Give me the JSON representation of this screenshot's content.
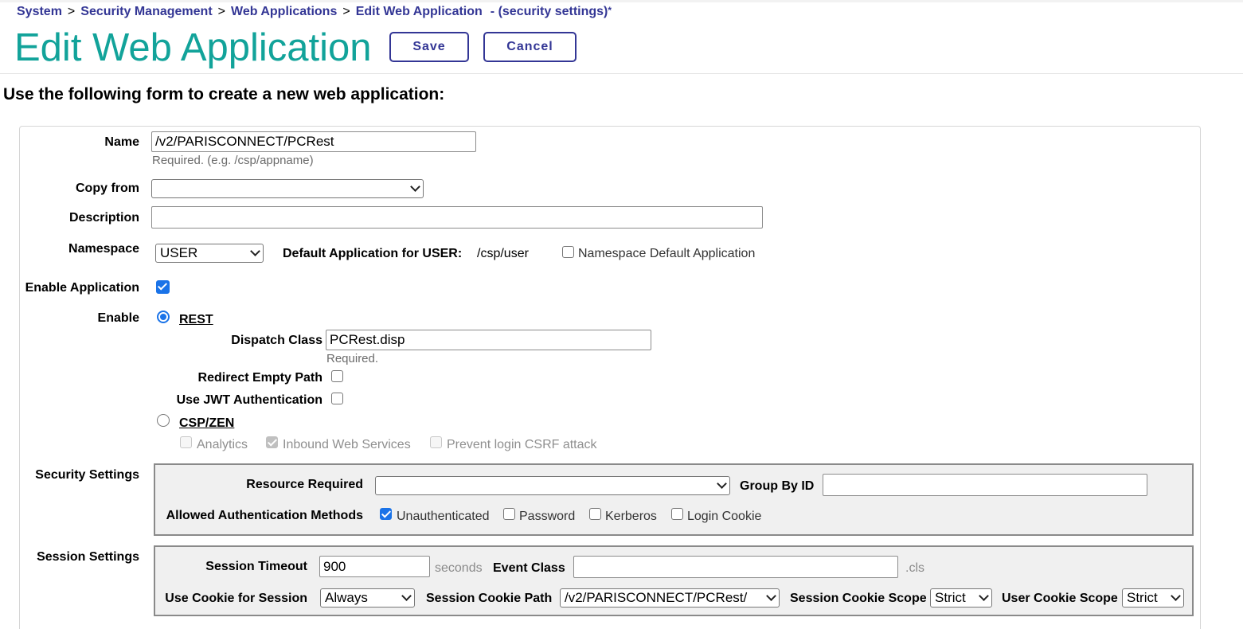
{
  "breadcrumb": {
    "items": [
      "System",
      "Security Management",
      "Web Applications",
      "Edit Web Application"
    ],
    "separator": ">",
    "suffix": "- (security settings)",
    "dirty_marker": "*"
  },
  "header": {
    "title": "Edit Web Application",
    "save_label": "Save",
    "cancel_label": "Cancel"
  },
  "intro": "Use the following form to create a new web application:",
  "form": {
    "name": {
      "label": "Name",
      "value": "/v2/PARISCONNECT/PCRest",
      "hint": "Required. (e.g. /csp/appname)"
    },
    "copy_from": {
      "label": "Copy from",
      "value": ""
    },
    "description": {
      "label": "Description",
      "value": ""
    },
    "namespace": {
      "label": "Namespace",
      "value": "USER",
      "default_app_label": "Default Application for USER:",
      "default_app_value": "/csp/user",
      "ns_default_label": "Namespace Default Application",
      "ns_default_checked": false
    },
    "enable_application": {
      "label": "Enable Application",
      "checked": true
    },
    "enable": {
      "label": "Enable",
      "rest": {
        "label": "REST",
        "selected": true,
        "dispatch_class_label": "Dispatch Class",
        "dispatch_class_value": "PCRest.disp",
        "dispatch_hint": "Required.",
        "redirect_empty_path_label": "Redirect Empty Path",
        "redirect_empty_path_checked": false,
        "use_jwt_label": "Use JWT Authentication",
        "use_jwt_checked": false
      },
      "csp": {
        "label": "CSP/ZEN",
        "selected": false,
        "analytics_label": "Analytics",
        "analytics_checked": false,
        "inbound_label": "Inbound Web Services",
        "inbound_checked": true,
        "csrf_label": "Prevent login CSRF attack",
        "csrf_checked": false
      }
    },
    "security_settings": {
      "label": "Security Settings",
      "resource_required_label": "Resource Required",
      "resource_required_value": "",
      "group_by_id_label": "Group By ID",
      "group_by_id_value": "",
      "auth_methods_label": "Allowed Authentication Methods",
      "methods": [
        {
          "label": "Unauthenticated",
          "checked": true
        },
        {
          "label": "Password",
          "checked": false
        },
        {
          "label": "Kerberos",
          "checked": false
        },
        {
          "label": "Login Cookie",
          "checked": false
        }
      ]
    },
    "session_settings": {
      "label": "Session Settings",
      "timeout_label": "Session Timeout",
      "timeout_value": "900",
      "timeout_unit": "seconds",
      "event_class_label": "Event Class",
      "event_class_value": "",
      "event_class_suffix": ".cls",
      "use_cookie_label": "Use Cookie for Session",
      "use_cookie_value": "Always",
      "cookie_path_label": "Session Cookie Path",
      "cookie_path_value": "/v2/PARISCONNECT/PCRest/",
      "cookie_scope_label": "Session Cookie Scope",
      "cookie_scope_value": "Strict",
      "user_cookie_scope_label": "User Cookie Scope",
      "user_cookie_scope_value": "Strict"
    }
  },
  "colors": {
    "title": "#12a39a",
    "link": "#333695",
    "checkbox_accent": "#1a73e8",
    "panel_bg": "#f0f0f0"
  }
}
